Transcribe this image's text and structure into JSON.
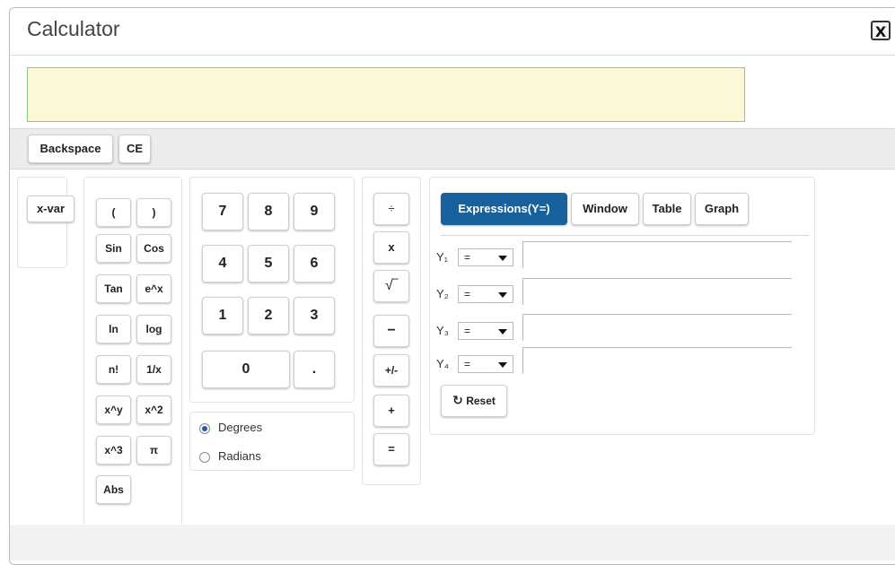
{
  "window": {
    "title": "Calculator",
    "close_icon": "X"
  },
  "display": {
    "value": ""
  },
  "edit": {
    "backspace": "Backspace",
    "ce": "CE"
  },
  "xvar": {
    "label": "x-var"
  },
  "functions": {
    "open_paren": "(",
    "close_paren": ")",
    "sin": "Sin",
    "cos": "Cos",
    "tan": "Tan",
    "exp": "e^x",
    "ln": "ln",
    "log": "log",
    "factorial": "n!",
    "reciprocal": "1/x",
    "power": "x^y",
    "square": "x^2",
    "cube": "x^3",
    "pi": "π",
    "abs": "Abs"
  },
  "digits": {
    "d7": "7",
    "d8": "8",
    "d9": "9",
    "d4": "4",
    "d5": "5",
    "d6": "6",
    "d1": "1",
    "d2": "2",
    "d3": "3",
    "d0": "0",
    "dot": "."
  },
  "angle": {
    "degrees": "Degrees",
    "radians": "Radians",
    "selected": "Degrees"
  },
  "ops": {
    "divide": "÷",
    "multiply": "x",
    "sqrt": "√‾",
    "minus": "−",
    "negate": "+/-",
    "plus": "+",
    "equals": "="
  },
  "graph_tabs": {
    "expressions": "Expressions(Y=)",
    "window": "Window",
    "table": "Table",
    "graph": "Graph",
    "active": "expressions"
  },
  "expressions": [
    {
      "label": "Y₁",
      "relation": "=",
      "value": ""
    },
    {
      "label": "Y₂",
      "relation": "=",
      "value": ""
    },
    {
      "label": "Y₃",
      "relation": "=",
      "value": ""
    },
    {
      "label": "Y₄",
      "relation": "=",
      "value": ""
    }
  ],
  "reset": {
    "label": "Reset",
    "icon": "refresh-icon"
  },
  "colors": {
    "accent": "#17629e",
    "display_bg": "#fbf8d5",
    "display_border": "#8bc889"
  }
}
